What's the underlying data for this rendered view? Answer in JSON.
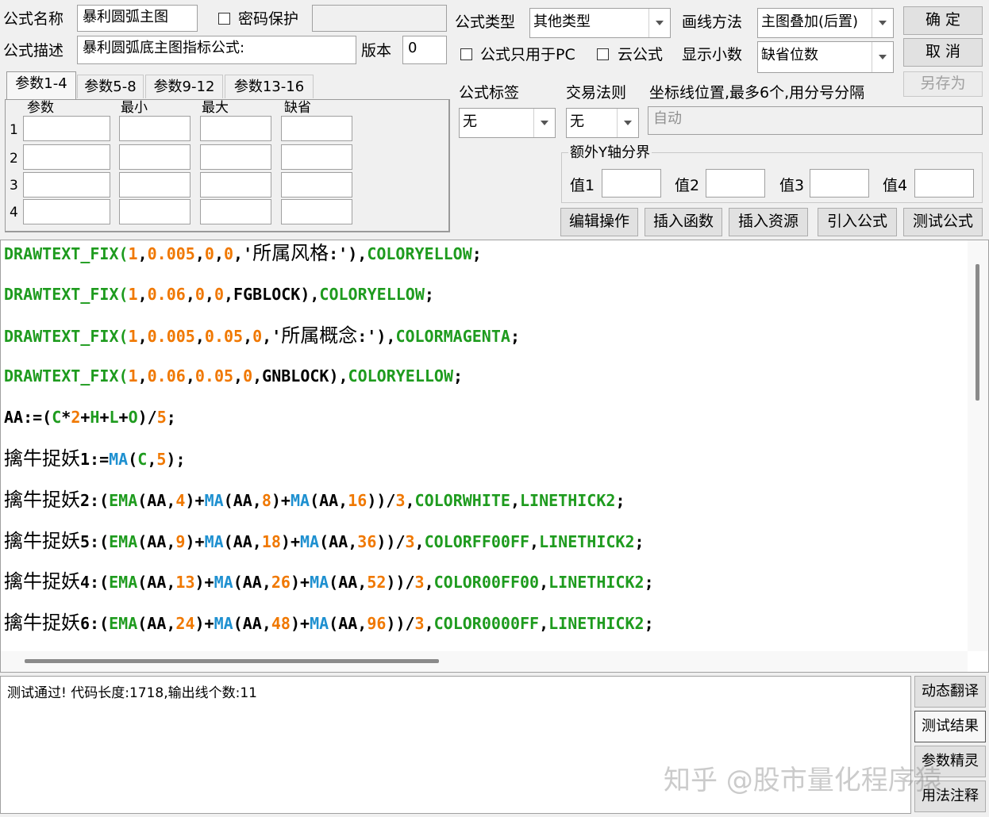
{
  "form": {
    "name_label": "公式名称",
    "name_value": "暴利圆弧主图",
    "password_label": "密码保护",
    "password_value": "",
    "desc_label": "公式描述",
    "desc_value": "暴利圆弧底主图指标公式:",
    "version_label": "版本",
    "version_value": "0",
    "type_label": "公式类型",
    "type_value": "其他类型",
    "draw_label": "画线方法",
    "draw_value": "主图叠加(后置)",
    "pc_only_label": "公式只用于PC",
    "cloud_label": "云公式",
    "decimals_label": "显示小数",
    "decimals_value": "缺省位数",
    "tag_label": "公式标签",
    "tag_value": "无",
    "trade_label": "交易法则",
    "trade_value": "无",
    "axis_label": "坐标线位置,最多6个,用分号分隔",
    "axis_value": "自动"
  },
  "buttons": {
    "ok": "确  定",
    "cancel": "取  消",
    "save_as": "另存为",
    "edit_ops": "编辑操作",
    "insert_func": "插入函数",
    "insert_res": "插入资源",
    "import_formula": "引入公式",
    "test_formula": "测试公式"
  },
  "tabs": [
    "参数1-4",
    "参数5-8",
    "参数9-12",
    "参数13-16"
  ],
  "params": {
    "headers": [
      "参数",
      "最小",
      "最大",
      "缺省"
    ],
    "rows": [
      "1",
      "2",
      "3",
      "4"
    ]
  },
  "yaxis": {
    "title": "额外Y轴分界",
    "labels": [
      "值1",
      "值2",
      "值3",
      "值4"
    ]
  },
  "code": [
    [
      [
        "DRAWTEXT_FIX(",
        "#1e9b1e"
      ],
      [
        "1",
        "#f07800"
      ],
      [
        ",",
        "#000000"
      ],
      [
        "0.005",
        "#f07800"
      ],
      [
        ",",
        "#000000"
      ],
      [
        "0",
        "#f07800"
      ],
      [
        ",",
        "#000000"
      ],
      [
        "0",
        "#f07800"
      ],
      [
        ",'所属风格:')",
        "#000000"
      ],
      [
        ",",
        "#000000"
      ],
      [
        "COLORYELLOW",
        "#1e9b1e"
      ],
      [
        ";",
        "#000000"
      ]
    ],
    [
      [
        "DRAWTEXT_FIX(",
        "#1e9b1e"
      ],
      [
        "1",
        "#f07800"
      ],
      [
        ",",
        "#000000"
      ],
      [
        "0.06",
        "#f07800"
      ],
      [
        ",",
        "#000000"
      ],
      [
        "0",
        "#f07800"
      ],
      [
        ",",
        "#000000"
      ],
      [
        "0",
        "#f07800"
      ],
      [
        ",FGBLOCK),",
        "#000000"
      ],
      [
        "COLORYELLOW",
        "#1e9b1e"
      ],
      [
        ";",
        "#000000"
      ]
    ],
    [
      [
        "DRAWTEXT_FIX(",
        "#1e9b1e"
      ],
      [
        "1",
        "#f07800"
      ],
      [
        ",",
        "#000000"
      ],
      [
        "0.005",
        "#f07800"
      ],
      [
        ",",
        "#000000"
      ],
      [
        "0.05",
        "#f07800"
      ],
      [
        ",",
        "#000000"
      ],
      [
        "0",
        "#f07800"
      ],
      [
        ",'所属概念:')",
        "#000000"
      ],
      [
        ",",
        "#000000"
      ],
      [
        "COLORMAGENTA",
        "#1e9b1e"
      ],
      [
        ";",
        "#000000"
      ]
    ],
    [
      [
        "DRAWTEXT_FIX(",
        "#1e9b1e"
      ],
      [
        "1",
        "#f07800"
      ],
      [
        ",",
        "#000000"
      ],
      [
        "0.06",
        "#f07800"
      ],
      [
        ",",
        "#000000"
      ],
      [
        "0.05",
        "#f07800"
      ],
      [
        ",",
        "#000000"
      ],
      [
        "0",
        "#f07800"
      ],
      [
        ",GNBLOCK),",
        "#000000"
      ],
      [
        "COLORYELLOW",
        "#1e9b1e"
      ],
      [
        ";",
        "#000000"
      ]
    ],
    [
      [
        "AA:=(",
        "#000000"
      ],
      [
        "C",
        "#1e9b1e"
      ],
      [
        "*",
        "#000000"
      ],
      [
        "2",
        "#f07800"
      ],
      [
        "+",
        "#000000"
      ],
      [
        "H",
        "#1e9b1e"
      ],
      [
        "+",
        "#000000"
      ],
      [
        "L",
        "#1e9b1e"
      ],
      [
        "+",
        "#000000"
      ],
      [
        "O",
        "#1e9b1e"
      ],
      [
        ")/",
        "#000000"
      ],
      [
        "5",
        "#f07800"
      ],
      [
        ";",
        "#000000"
      ]
    ],
    [
      [
        "擒牛捉妖1:=",
        "#000000"
      ],
      [
        "MA",
        "#1e90d0"
      ],
      [
        "(",
        "#000000"
      ],
      [
        "C",
        "#1e9b1e"
      ],
      [
        ",",
        "#000000"
      ],
      [
        "5",
        "#f07800"
      ],
      [
        ");",
        "#000000"
      ]
    ],
    [
      [
        "擒牛捉妖2:(",
        "#000000"
      ],
      [
        "EMA",
        "#1e9b1e"
      ],
      [
        "(AA,",
        "#000000"
      ],
      [
        "4",
        "#f07800"
      ],
      [
        ")+",
        "#000000"
      ],
      [
        "MA",
        "#1e90d0"
      ],
      [
        "(AA,",
        "#000000"
      ],
      [
        "8",
        "#f07800"
      ],
      [
        ")+",
        "#000000"
      ],
      [
        "MA",
        "#1e90d0"
      ],
      [
        "(AA,",
        "#000000"
      ],
      [
        "16",
        "#f07800"
      ],
      [
        "))/",
        "#000000"
      ],
      [
        "3",
        "#f07800"
      ],
      [
        ",",
        "#000000"
      ],
      [
        "COLORWHITE",
        "#1e9b1e"
      ],
      [
        ",",
        "#000000"
      ],
      [
        "LINETHICK2",
        "#1e9b1e"
      ],
      [
        ";",
        "#000000"
      ]
    ],
    [
      [
        "擒牛捉妖5:(",
        "#000000"
      ],
      [
        "EMA",
        "#1e9b1e"
      ],
      [
        "(AA,",
        "#000000"
      ],
      [
        "9",
        "#f07800"
      ],
      [
        ")+",
        "#000000"
      ],
      [
        "MA",
        "#1e90d0"
      ],
      [
        "(AA,",
        "#000000"
      ],
      [
        "18",
        "#f07800"
      ],
      [
        ")+",
        "#000000"
      ],
      [
        "MA",
        "#1e90d0"
      ],
      [
        "(AA,",
        "#000000"
      ],
      [
        "36",
        "#f07800"
      ],
      [
        "))/",
        "#000000"
      ],
      [
        "3",
        "#f07800"
      ],
      [
        ",",
        "#000000"
      ],
      [
        "COLORFF00FF",
        "#1e9b1e"
      ],
      [
        ",",
        "#000000"
      ],
      [
        "LINETHICK2",
        "#1e9b1e"
      ],
      [
        ";",
        "#000000"
      ]
    ],
    [
      [
        "擒牛捉妖4:(",
        "#000000"
      ],
      [
        "EMA",
        "#1e9b1e"
      ],
      [
        "(AA,",
        "#000000"
      ],
      [
        "13",
        "#f07800"
      ],
      [
        ")+",
        "#000000"
      ],
      [
        "MA",
        "#1e90d0"
      ],
      [
        "(AA,",
        "#000000"
      ],
      [
        "26",
        "#f07800"
      ],
      [
        ")+",
        "#000000"
      ],
      [
        "MA",
        "#1e90d0"
      ],
      [
        "(AA,",
        "#000000"
      ],
      [
        "52",
        "#f07800"
      ],
      [
        "))/",
        "#000000"
      ],
      [
        "3",
        "#f07800"
      ],
      [
        ",",
        "#000000"
      ],
      [
        "COLOR00FF00",
        "#1e9b1e"
      ],
      [
        ",",
        "#000000"
      ],
      [
        "LINETHICK2",
        "#1e9b1e"
      ],
      [
        ";",
        "#000000"
      ]
    ],
    [
      [
        "擒牛捉妖6:(",
        "#000000"
      ],
      [
        "EMA",
        "#1e9b1e"
      ],
      [
        "(AA,",
        "#000000"
      ],
      [
        "24",
        "#f07800"
      ],
      [
        ")+",
        "#000000"
      ],
      [
        "MA",
        "#1e90d0"
      ],
      [
        "(AA,",
        "#000000"
      ],
      [
        "48",
        "#f07800"
      ],
      [
        ")+",
        "#000000"
      ],
      [
        "MA",
        "#1e90d0"
      ],
      [
        "(AA,",
        "#000000"
      ],
      [
        "96",
        "#f07800"
      ],
      [
        "))/",
        "#000000"
      ],
      [
        "3",
        "#f07800"
      ],
      [
        ",",
        "#000000"
      ],
      [
        "COLOR0000FF",
        "#1e9b1e"
      ],
      [
        ",",
        "#000000"
      ],
      [
        "LINETHICK2",
        "#1e9b1e"
      ],
      [
        ";",
        "#000000"
      ]
    ]
  ],
  "status": "测试通过! 代码长度:1718,输出线个数:11",
  "side_buttons": [
    "动态翻译",
    "测试结果",
    "参数精灵",
    "用法注释"
  ],
  "watermark": "知乎 @股市量化程序猿"
}
